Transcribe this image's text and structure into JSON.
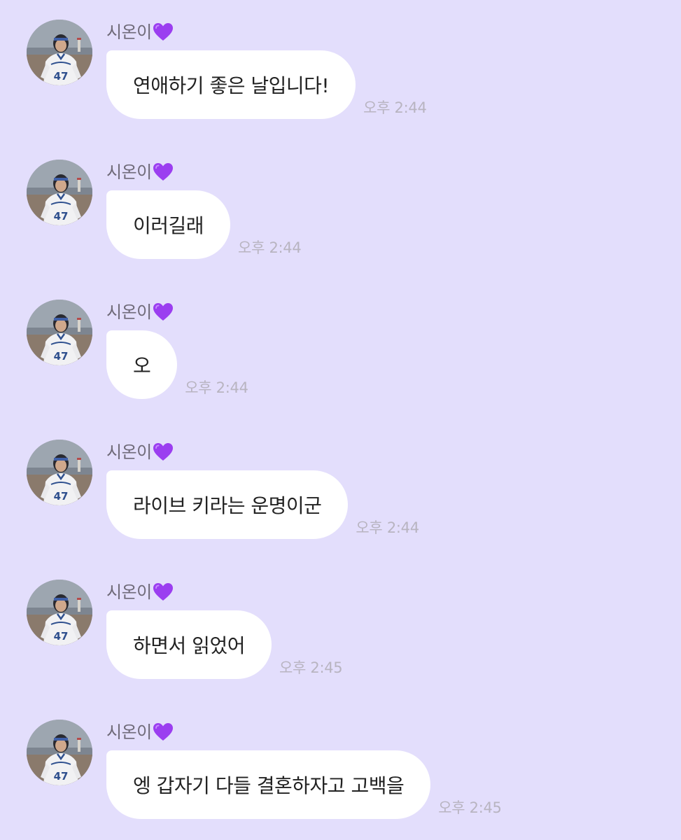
{
  "colors": {
    "background": "#e3defc",
    "bubble": "#ffffff",
    "sender_name": "#6f6a78",
    "timestamp": "#b8b4c0",
    "heart": "#9b3ef0"
  },
  "messages": [
    {
      "sender": "시온이",
      "sender_icon": "purple-heart-icon",
      "avatar": "profile-photo",
      "text": "연애하기 좋은 날입니다!",
      "time": "오후 2:44"
    },
    {
      "sender": "시온이",
      "sender_icon": "purple-heart-icon",
      "avatar": "profile-photo",
      "text": "이러길래",
      "time": "오후 2:44"
    },
    {
      "sender": "시온이",
      "sender_icon": "purple-heart-icon",
      "avatar": "profile-photo",
      "text": "오",
      "time": "오후 2:44"
    },
    {
      "sender": "시온이",
      "sender_icon": "purple-heart-icon",
      "avatar": "profile-photo",
      "text": "라이브 키라는 운명이군",
      "time": "오후 2:44"
    },
    {
      "sender": "시온이",
      "sender_icon": "purple-heart-icon",
      "avatar": "profile-photo",
      "text": "하면서 읽었어",
      "time": "오후 2:45"
    },
    {
      "sender": "시온이",
      "sender_icon": "purple-heart-icon",
      "avatar": "profile-photo",
      "text": "엥 갑자기 다들 결혼하자고 고백을",
      "time": "오후 2:45"
    }
  ]
}
